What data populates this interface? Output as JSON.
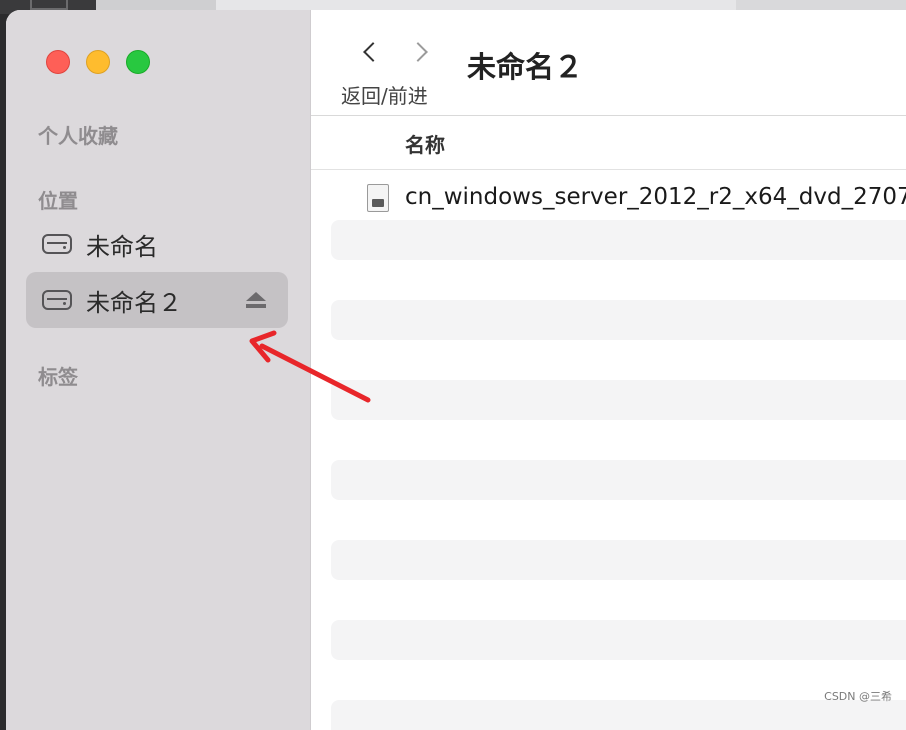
{
  "sidebar": {
    "favorites_title": "个人收藏",
    "locations_title": "位置",
    "tags_title": "标签",
    "items": [
      {
        "label": "未命名",
        "icon": "disk-icon",
        "selected": false
      },
      {
        "label": "未命名２",
        "icon": "disk-icon",
        "selected": true,
        "ejectable": true
      }
    ]
  },
  "toolbar": {
    "nav_label": "返回/前进",
    "title": "未命名２"
  },
  "list": {
    "column_name": "名称",
    "files": [
      {
        "name": "cn_windows_server_2012_r2_x64_dvd_2707",
        "icon": "disk-image-icon"
      }
    ]
  },
  "annotation": {
    "color": "#e8262a"
  },
  "watermark": "CSDN @三希"
}
